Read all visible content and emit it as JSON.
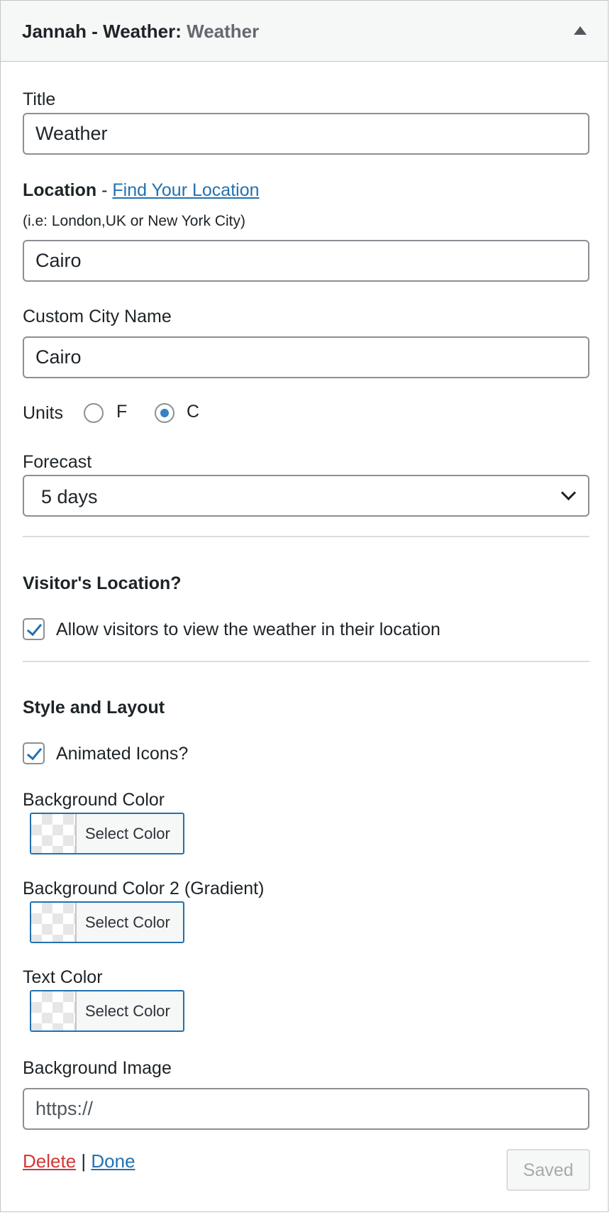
{
  "widget": {
    "title_prefix": "Jannah - Weather:",
    "title_sub": "Weather"
  },
  "fields": {
    "title": {
      "label": "Title",
      "value": "Weather"
    },
    "location": {
      "label": "Location",
      "separator": " - ",
      "link": "Find Your Location",
      "hint": "(i.e: London,UK or New York City)",
      "value": "Cairo"
    },
    "custom_city": {
      "label": "Custom City Name",
      "value": "Cairo"
    },
    "units": {
      "label": "Units",
      "options": [
        {
          "label": "F",
          "checked": false
        },
        {
          "label": "C",
          "checked": true
        }
      ]
    },
    "forecast": {
      "label": "Forecast",
      "selected": "5 days"
    }
  },
  "visitor_location": {
    "heading": "Visitor's Location?",
    "checkbox_label": "Allow visitors to view the weather in their location",
    "checked": true
  },
  "style_layout": {
    "heading": "Style and Layout",
    "animated_icons_label": "Animated Icons?",
    "animated_icons_checked": true,
    "colors": [
      {
        "label": "Background Color",
        "button": "Select Color"
      },
      {
        "label": "Background Color 2 (Gradient)",
        "button": "Select Color"
      },
      {
        "label": "Text Color",
        "button": "Select Color"
      }
    ],
    "background_image": {
      "label": "Background Image",
      "placeholder": "https://"
    }
  },
  "footer": {
    "delete": "Delete",
    "separator": "|",
    "done": "Done",
    "saved": "Saved"
  },
  "colors": {
    "link": "#2271b1",
    "delete": "#d63638",
    "radio_checked": "#3582c4"
  }
}
